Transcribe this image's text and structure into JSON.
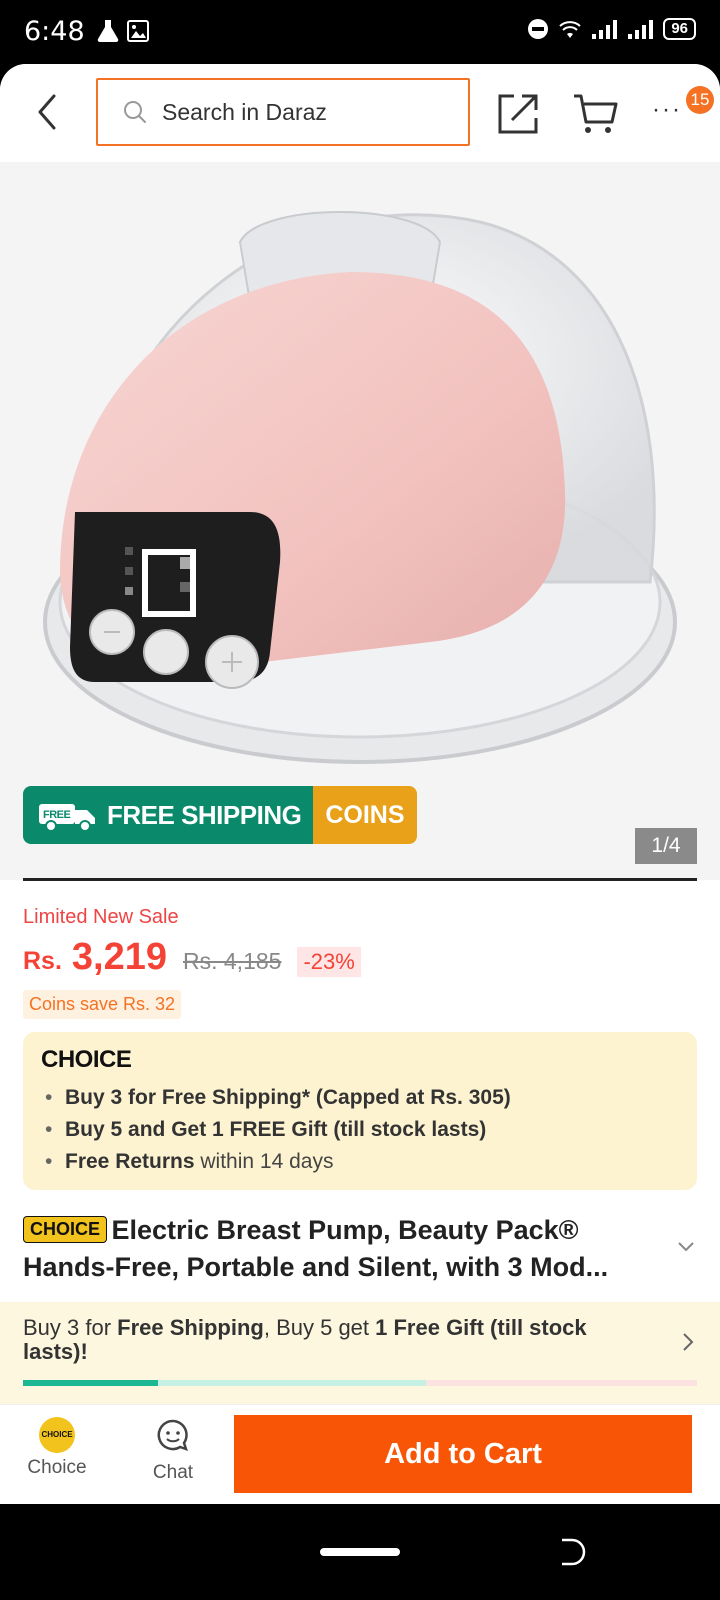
{
  "status_bar": {
    "time": "6:48",
    "battery": "96"
  },
  "header": {
    "search_placeholder": "Search in Daraz",
    "more_badge": "15"
  },
  "gallery": {
    "free_shipping_label": "FREE SHIPPING",
    "free_tag": "FREE",
    "coins_label": "COINS",
    "page_indicator": "1/4"
  },
  "product": {
    "sale_label": "Limited New Sale",
    "currency": "Rs.",
    "price": "3,219",
    "old_price": "Rs. 4,185",
    "discount": "-23%",
    "coins_save": "Coins save Rs. 32",
    "choice_logo": "CHOICE",
    "choice_benefits": [
      {
        "bold": "Buy 3 for  Free Shipping* (Capped at Rs. 305)",
        "rest": ""
      },
      {
        "bold": "Buy 5 and Get 1 FREE Gift (till stock lasts)",
        "rest": ""
      },
      {
        "bold": "Free Returns",
        "rest": " within 14 days"
      }
    ],
    "title_chip": "CHOICE",
    "title": "Electric Breast Pump, Beauty Pack® Hands-Free, Portable and Silent, with 3 Mod..."
  },
  "promo": {
    "part1": "Buy 3 for ",
    "bold1": "Free Shipping",
    "part2": ", Buy 5 get ",
    "bold2": "1 Free Gift (till stock lasts)!",
    "progress": 0.2
  },
  "action_bar": {
    "choice_label": "Choice",
    "choice_coin": "CHOICE",
    "chat_label": "Chat",
    "add_to_cart": "Add to Cart"
  },
  "colors": {
    "accent": "#f57224",
    "price": "#f44336",
    "add_to_cart": "#f85606",
    "free_shipping_green": "#0a8a6a",
    "coins_gold": "#e8a118"
  }
}
